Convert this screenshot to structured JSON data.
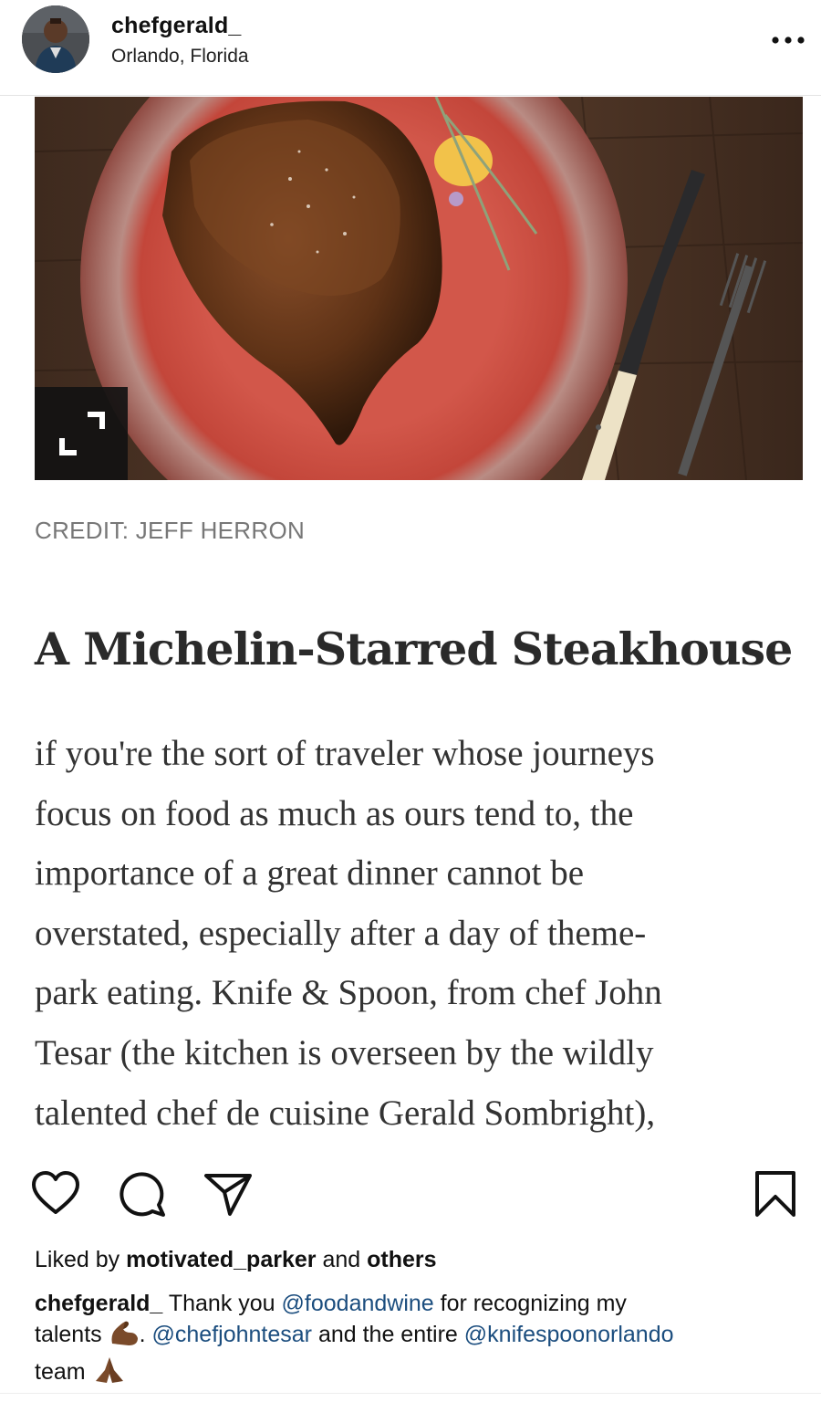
{
  "post": {
    "username": "chefgerald_",
    "location": "Orlando, Florida",
    "more_icon": "more-horizontal-icon"
  },
  "image": {
    "alt": "Steak on a red plate with knife and fork",
    "expand_icon": "expand-icon"
  },
  "article": {
    "credit": "CREDIT: JEFF HERRON",
    "title": "A Michelin-Starred Steakhouse",
    "lines": [
      "if you're the sort of traveler whose journeys",
      "focus on food as much as ours tend to, the",
      "importance of a great dinner cannot be",
      "overstated, especially after a day of theme-",
      "park eating. Knife & Spoon, from chef John",
      "Tesar (the kitchen is overseen by the wildly",
      "talented chef de cuisine Gerald Sombright),"
    ]
  },
  "actions": {
    "like_icon": "heart-icon",
    "comment_icon": "comment-icon",
    "share_icon": "send-icon",
    "save_icon": "bookmark-icon"
  },
  "likes": {
    "prefix": "Liked by",
    "user": "motivated_parker",
    "conj": "and",
    "others": "others"
  },
  "caption": {
    "username": "chefgerald_",
    "text1": " Thank you ",
    "mention1": "@foodandwine",
    "text2": " for recognizing my",
    "text3": "talents ",
    "text4": ". ",
    "mention2": "@chefjohntesar",
    "text5": " and the entire ",
    "mention3": "@knifespoonorlando",
    "text6": "team "
  },
  "colors": {
    "mention": "#1b4d7e",
    "plate": "#c94a3f",
    "wood": "#4a3224"
  }
}
